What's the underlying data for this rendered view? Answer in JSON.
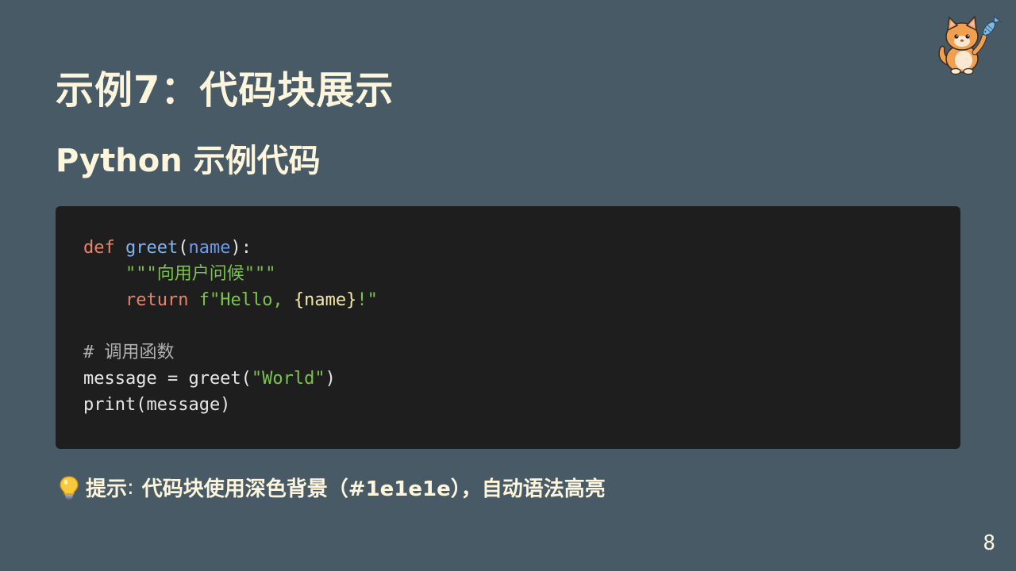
{
  "slide": {
    "title": "示例7：代码块展示",
    "subtitle": "Python 示例代码",
    "page_number": "8"
  },
  "mascot": {
    "icon": "cat-with-fish-icon"
  },
  "code": {
    "line1": {
      "kw": "def",
      "fn": "greet",
      "open": "(",
      "param": "name",
      "close": "):"
    },
    "line2": {
      "indent": "    ",
      "docstring": "\"\"\"向用户问候\"\"\""
    },
    "line3": {
      "indent": "    ",
      "kw": "return",
      "prefix": "f\"Hello, ",
      "interp": "{name}",
      "suffix": "!\""
    },
    "line5": {
      "comment": "# 调用函数"
    },
    "line6": {
      "pre": "message = greet(",
      "str": "\"World\"",
      "post": ")"
    },
    "line7": {
      "text": "print(message)"
    }
  },
  "tip": {
    "icon": "lightbulb-icon",
    "label": "提示",
    "colon": ":",
    "text": "代码块使用深色背景（#1e1e1e），自动语法高亮"
  },
  "colors": {
    "background": "#485a66",
    "code_background": "#1e1e1e",
    "heading": "#fdf6dc",
    "keyword": "#e8826a",
    "function": "#82b4f0",
    "string": "#7cc24e"
  }
}
